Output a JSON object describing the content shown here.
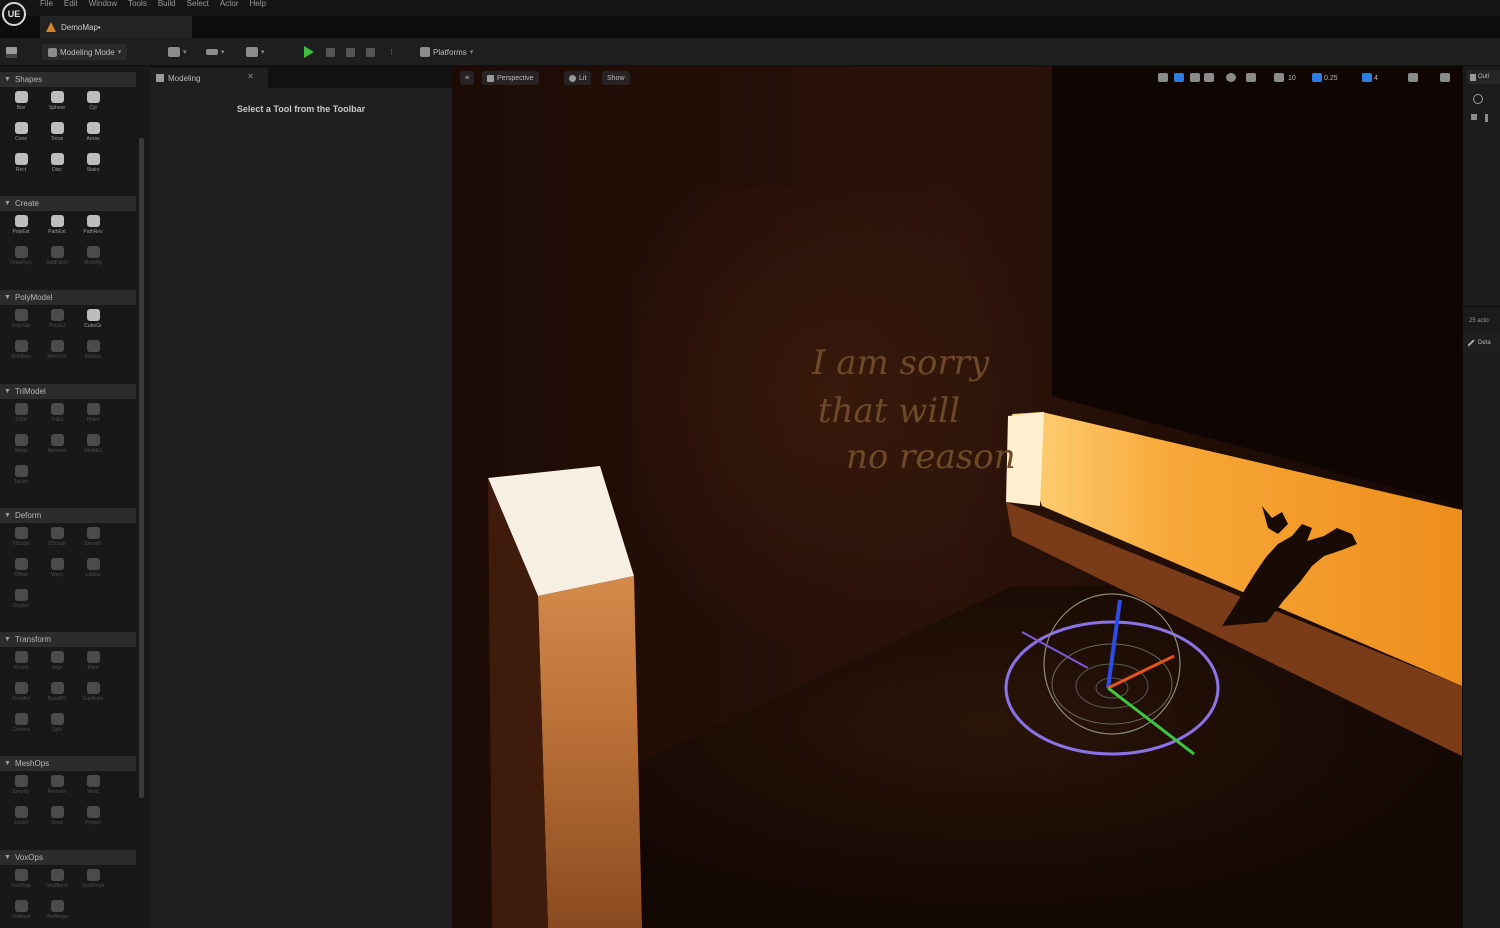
{
  "app": {
    "logo_text": "UE"
  },
  "menu": {
    "items": [
      "File",
      "Edit",
      "Window",
      "Tools",
      "Build",
      "Select",
      "Actor",
      "Help"
    ]
  },
  "tabs": {
    "map_tab": "DemoMap•"
  },
  "toolbar": {
    "mode_label": "Modeling Mode",
    "platforms_label": "Platforms"
  },
  "palette": {
    "sections": [
      {
        "name": "Shapes",
        "tools": [
          {
            "label": "Box",
            "enabled": true
          },
          {
            "label": "Sphere",
            "enabled": true
          },
          {
            "label": "Cyl",
            "enabled": true
          },
          {
            "label": "Cone",
            "enabled": true
          },
          {
            "label": "Torus",
            "enabled": true
          },
          {
            "label": "Arrow",
            "enabled": true
          },
          {
            "label": "Rect",
            "enabled": true
          },
          {
            "label": "Disc",
            "enabled": true
          },
          {
            "label": "Stairs",
            "enabled": true
          }
        ]
      },
      {
        "name": "Create",
        "tools": [
          {
            "label": "PolyExt",
            "enabled": true
          },
          {
            "label": "PathExt",
            "enabled": true
          },
          {
            "label": "PathRev",
            "enabled": true
          },
          {
            "label": "DrawPoly",
            "enabled": false
          },
          {
            "label": "AddPatch",
            "enabled": false
          },
          {
            "label": "MshMrg",
            "enabled": false
          }
        ]
      },
      {
        "name": "PolyModel",
        "tools": [
          {
            "label": "PolyGrp",
            "enabled": false
          },
          {
            "label": "PolyEd",
            "enabled": false
          },
          {
            "label": "CubeGr",
            "enabled": true
          },
          {
            "label": "MshBool",
            "enabled": false
          },
          {
            "label": "MshTrim",
            "enabled": false
          },
          {
            "label": "MshSlc",
            "enabled": false
          }
        ]
      },
      {
        "name": "TriModel",
        "tools": [
          {
            "label": "TriSel",
            "enabled": false
          },
          {
            "label": "TriEd",
            "enabled": false
          },
          {
            "label": "Holes",
            "enabled": false
          },
          {
            "label": "Simpl",
            "enabled": false
          },
          {
            "label": "Remesh",
            "enabled": false
          },
          {
            "label": "WeldEd",
            "enabled": false
          },
          {
            "label": "Jacket",
            "enabled": false
          }
        ]
      },
      {
        "name": "Deform",
        "tools": [
          {
            "label": "VSculpt",
            "enabled": false
          },
          {
            "label": "DSculpt",
            "enabled": false
          },
          {
            "label": "Smooth",
            "enabled": false
          },
          {
            "label": "Offset",
            "enabled": false
          },
          {
            "label": "Warp",
            "enabled": false
          },
          {
            "label": "Lattice",
            "enabled": false
          },
          {
            "label": "Displce",
            "enabled": false
          }
        ]
      },
      {
        "name": "Transform",
        "tools": [
          {
            "label": "XForm",
            "enabled": false
          },
          {
            "label": "Align",
            "enabled": false
          },
          {
            "label": "Pivot",
            "enabled": false
          },
          {
            "label": "PivotAct",
            "enabled": false
          },
          {
            "label": "BakeRS",
            "enabled": false
          },
          {
            "label": "Duplicate",
            "enabled": false
          },
          {
            "label": "Convert",
            "enabled": false
          },
          {
            "label": "Split",
            "enabled": false
          }
        ]
      },
      {
        "name": "MeshOps",
        "tools": [
          {
            "label": "Simplify",
            "enabled": false
          },
          {
            "label": "Remesh",
            "enabled": false
          },
          {
            "label": "Weld",
            "enabled": false
          },
          {
            "label": "Jacket",
            "enabled": false
          },
          {
            "label": "Voxel",
            "enabled": false
          },
          {
            "label": "Project",
            "enabled": false
          }
        ]
      },
      {
        "name": "VoxOps",
        "tools": [
          {
            "label": "VoxWrap",
            "enabled": false
          },
          {
            "label": "VoxBlend",
            "enabled": false
          },
          {
            "label": "VoxMorph",
            "enabled": false
          },
          {
            "label": "VoxBool",
            "enabled": false
          },
          {
            "label": "VoxMerge",
            "enabled": false
          }
        ]
      }
    ]
  },
  "modeling_panel": {
    "tab_label": "Modeling",
    "message": "Select a Tool from the Toolbar"
  },
  "viewport": {
    "perspective_label": "Perspective",
    "lit_label": "Lit",
    "show_label": "Show",
    "grid_snap": "10",
    "rot_snap": "0.25",
    "scale_snap": "4",
    "wall_writing": [
      "I am sorry",
      "that will",
      "no reason"
    ]
  },
  "right_panel": {
    "outliner_label": "Outl",
    "actor_count": "25 acto",
    "details_label": "Deta"
  },
  "colors": {
    "accent": "#2d7ee0",
    "play": "#3fbf3f",
    "gizmo_ring": "#8a73e6"
  }
}
